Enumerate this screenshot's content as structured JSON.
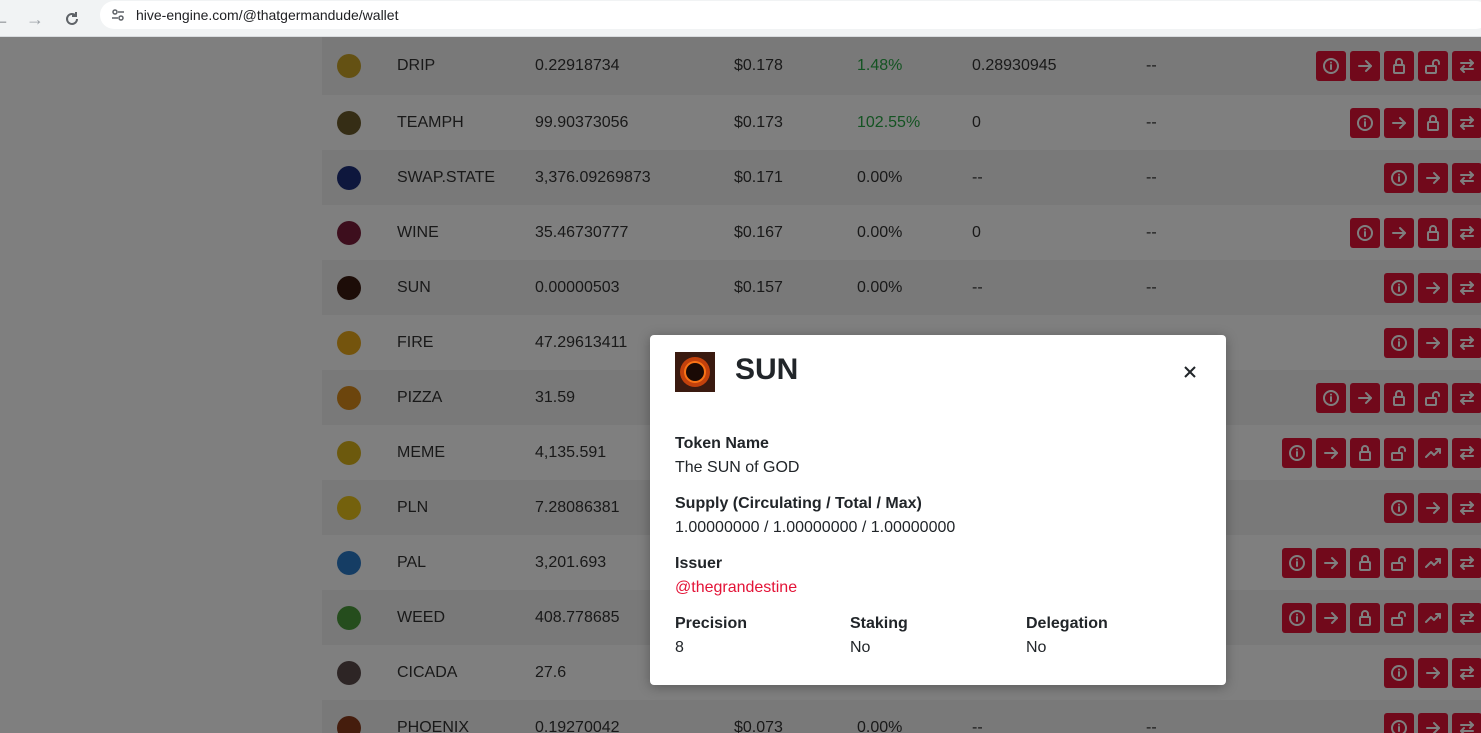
{
  "browser": {
    "url": "hive-engine.com/@thatgermandude/wallet"
  },
  "rows": [
    {
      "symbol": "DRIP",
      "balance": "0.22918734",
      "price": "$0.178",
      "change": "1.48%",
      "change_positive": true,
      "stake": "0.28930945",
      "delegated": "--",
      "icon_color": "#c9a227",
      "actions": [
        "info",
        "transfer",
        "stake",
        "unstake",
        "swap"
      ]
    },
    {
      "symbol": "TEAMPH",
      "balance": "99.90373056",
      "price": "$0.173",
      "change": "102.55%",
      "change_positive": true,
      "stake": "0",
      "delegated": "--",
      "icon_color": "#6b5a2a",
      "actions": [
        "info",
        "transfer",
        "stake",
        "swap"
      ]
    },
    {
      "symbol": "SWAP.STATE",
      "balance": "3,376.09269873",
      "price": "$0.171",
      "change": "0.00%",
      "change_positive": false,
      "stake": "--",
      "delegated": "--",
      "icon_color": "#1d2f7a",
      "actions": [
        "info",
        "transfer",
        "swap"
      ]
    },
    {
      "symbol": "WINE",
      "balance": "35.46730777",
      "price": "$0.167",
      "change": "0.00%",
      "change_positive": false,
      "stake": "0",
      "delegated": "--",
      "icon_color": "#7a1d3a",
      "actions": [
        "info",
        "transfer",
        "stake",
        "swap"
      ]
    },
    {
      "symbol": "SUN",
      "balance": "0.00000503",
      "price": "$0.157",
      "change": "0.00%",
      "change_positive": false,
      "stake": "--",
      "delegated": "--",
      "icon_color": "#3a1a10",
      "actions": [
        "info",
        "transfer",
        "swap"
      ]
    },
    {
      "symbol": "FIRE",
      "balance": "47.29613411",
      "price": "",
      "change": "",
      "change_positive": false,
      "stake": "",
      "delegated": "",
      "icon_color": "#e8a81a",
      "actions": [
        "info",
        "transfer",
        "swap"
      ]
    },
    {
      "symbol": "PIZZA",
      "balance": "31.59",
      "price": "",
      "change": "",
      "change_positive": false,
      "stake": "",
      "delegated": "",
      "icon_color": "#d98a1a",
      "actions": [
        "info",
        "transfer",
        "stake",
        "unstake",
        "swap"
      ]
    },
    {
      "symbol": "MEME",
      "balance": "4,135.591",
      "price": "",
      "change": "",
      "change_positive": false,
      "stake": "",
      "delegated": "",
      "icon_color": "#d9b31a",
      "actions": [
        "info",
        "transfer",
        "stake",
        "unstake",
        "trend",
        "swap"
      ]
    },
    {
      "symbol": "PLN",
      "balance": "7.28086381",
      "price": "",
      "change": "",
      "change_positive": false,
      "stake": "",
      "delegated": "",
      "icon_color": "#e8c21a",
      "actions": [
        "info",
        "transfer",
        "swap"
      ]
    },
    {
      "symbol": "PAL",
      "balance": "3,201.693",
      "price": "",
      "change": "",
      "change_positive": false,
      "stake": "",
      "delegated": "",
      "icon_color": "#2a7ac9",
      "actions": [
        "info",
        "transfer",
        "stake",
        "unstake",
        "trend",
        "swap"
      ]
    },
    {
      "symbol": "WEED",
      "balance": "408.778685",
      "price": "",
      "change": "",
      "change_positive": false,
      "stake": "",
      "delegated": "",
      "icon_color": "#4a9a3a",
      "actions": [
        "info",
        "transfer",
        "stake",
        "unstake",
        "trend",
        "swap"
      ]
    },
    {
      "symbol": "CICADA",
      "balance": "27.6",
      "price": "",
      "change": "",
      "change_positive": false,
      "stake": "",
      "delegated": "",
      "icon_color": "#5a4a4a",
      "actions": [
        "info",
        "transfer",
        "swap"
      ]
    },
    {
      "symbol": "PHOENIX",
      "balance": "0.19270042",
      "price": "$0.073",
      "change": "0.00%",
      "change_positive": false,
      "stake": "--",
      "delegated": "--",
      "icon_color": "#8a3a1a",
      "actions": [
        "info",
        "transfer",
        "swap"
      ]
    }
  ],
  "modal": {
    "title": "SUN",
    "token_name_label": "Token Name",
    "token_name": "The SUN of GOD",
    "supply_label": "Supply (Circulating / Total / Max)",
    "supply": "1.00000000 / 1.00000000 / 1.00000000",
    "issuer_label": "Issuer",
    "issuer": "@thegrandestine",
    "precision_label": "Precision",
    "precision": "8",
    "staking_label": "Staking",
    "staking": "No",
    "delegation_label": "Delegation",
    "delegation": "No"
  },
  "colors": {
    "accent": "#e31337",
    "positive": "#28a745"
  }
}
